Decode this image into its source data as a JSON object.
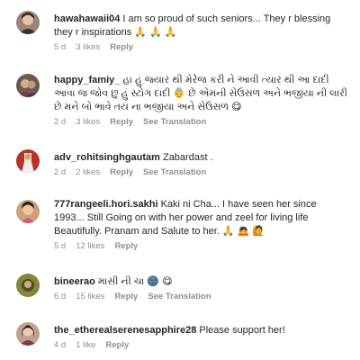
{
  "comments": [
    {
      "username": "hawahawaii04",
      "text": "I am so proud of such seniors... They r blessing they r inspirations 🙏 🙏 🙏",
      "time": "5 d",
      "likes": "3 likes",
      "reply": "Reply",
      "translate": "",
      "avatar_color": "#9a8478"
    },
    {
      "username": "happy_famiy_",
      "text": "હા હું જ્યાર થી મેરેજ કરી ને આવી ત્યાર થી આ દાદી આવા જ જોવ છુ હું સ્ટોગ દાદી 👵 છે એમની સેઉસળ અને ભજીયા ની લારી છે મને બો ભાવે તય ના ભજીયા અને સેઉસળ 😋",
      "time": "2 d",
      "likes": "3 likes",
      "reply": "Reply",
      "translate": "See Translation",
      "avatar_color": "#6b5a4e"
    },
    {
      "username": "adv_rohitsinghgautam",
      "text": "Zabardast .",
      "time": "2 d",
      "likes": "2 likes",
      "reply": "Reply",
      "translate": "See Translation",
      "avatar_color": "#b7322c"
    },
    {
      "username": "777rangeeli.hori.sakhi",
      "text": "Kaki ni Cha... I have seen her since 1993... Still Going on with her power and zeel for living life Beautifully. Pranam and Salute to her. 🙏 🙇 🙋",
      "time": "5 d",
      "likes": "12 likes",
      "reply": "Reply",
      "translate": "",
      "avatar_color": "#c9a27a"
    },
    {
      "username": "bineerao",
      "text": "માસી ની ચા 🌚 😋",
      "time": "6 d",
      "likes": "15 likes",
      "reply": "Reply",
      "translate": "See Translation",
      "avatar_color": "#7e8a3a"
    },
    {
      "username": "the_etherealserenesapphire28",
      "text": "Please support her!",
      "time": "4 d",
      "likes": "1 like",
      "reply": "Reply",
      "translate": "",
      "avatar_color": "#c4a08c"
    }
  ]
}
